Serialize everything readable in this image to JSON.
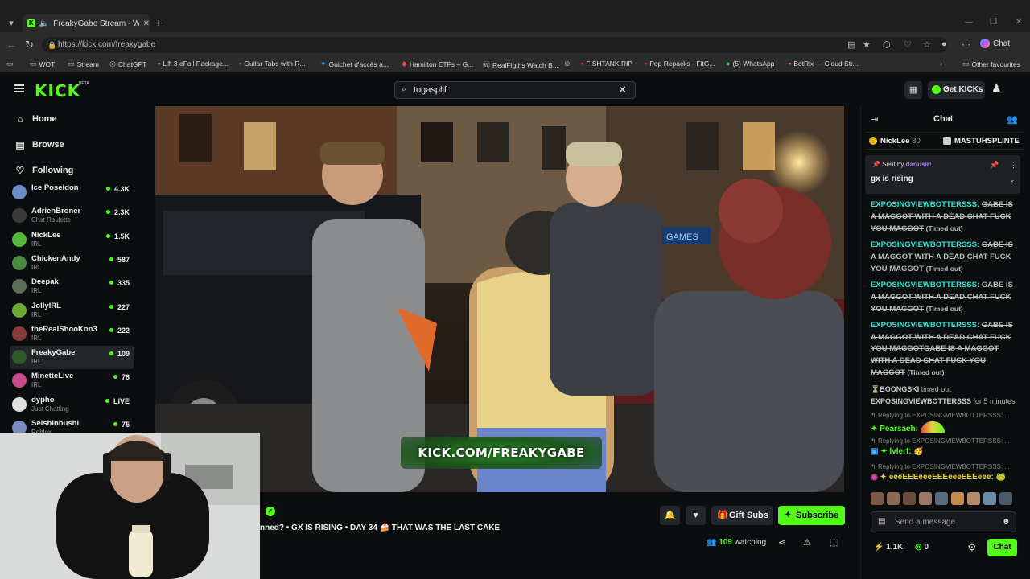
{
  "browser": {
    "tab_title": "FreakyGabe Stream - Watch Live",
    "url": "https://kick.com/freakygabe",
    "copilot_label": "Chat",
    "bookmarks": [
      "WOT",
      "Stream",
      "ChatGPT",
      "Lift 3 eFoil Package...",
      "Guitar Tabs with R...",
      "Guichet d'accès à...",
      "Hamilton ETFs – G...",
      "RealFigths Watch B...",
      "",
      "FISHTANK.RIP",
      "Pop Repacks - FitG...",
      "(5) WhatsApp",
      "BotRix — Cloud Str..."
    ],
    "other_favourites": "Other favourites"
  },
  "kick": {
    "logo": "KICK",
    "beta": "BETA",
    "search_value": "togasplif",
    "get_kicks": "Get KICKs"
  },
  "sidebar": {
    "nav": [
      {
        "label": "Home",
        "icon": "home-icon"
      },
      {
        "label": "Browse",
        "icon": "browse-icon"
      },
      {
        "label": "Following",
        "icon": "heart-icon"
      }
    ],
    "channels": [
      {
        "name": "Ice Poseidon",
        "category": "",
        "viewers": "4.3K",
        "color": "#6b8cc7"
      },
      {
        "name": "AdrienBroner",
        "category": "Chat Roulette",
        "viewers": "2.3K",
        "color": "#3a3a3a"
      },
      {
        "name": "NickLee",
        "category": "IRL",
        "viewers": "1.5K",
        "color": "#53b83a"
      },
      {
        "name": "ChickenAndy",
        "category": "IRL",
        "viewers": "587",
        "color": "#4b8a3f"
      },
      {
        "name": "Deepak",
        "category": "IRL",
        "viewers": "335",
        "color": "#5a6d55"
      },
      {
        "name": "JollyIRL",
        "category": "IRL",
        "viewers": "227",
        "color": "#6da832"
      },
      {
        "name": "theRealShooKon3",
        "category": "IRL",
        "viewers": "222",
        "color": "#8b3a3a"
      },
      {
        "name": "FreakyGabe",
        "category": "IRL",
        "viewers": "109",
        "color": "#2f5a2a"
      },
      {
        "name": "MinetteLive",
        "category": "IRL",
        "viewers": "78",
        "color": "#c94a8c"
      },
      {
        "name": "dypho",
        "category": "Just Chatting",
        "viewers": "LIVE",
        "color": "#e0e0e0"
      },
      {
        "name": "Seishinbushi",
        "category": "Roblox",
        "viewers": "75",
        "color": "#7a8dc2"
      }
    ]
  },
  "stream": {
    "watermark": "KICK.COM/FREAKYGABE",
    "title": "nned? • GX IS RISING • DAY 34 🍰 THAT WAS THE LAST CAKE",
    "gift_subs": "Gift Subs",
    "subscribe": "Subscribe",
    "watching_count": "109",
    "watching_label": "watching"
  },
  "chat": {
    "title": "Chat",
    "leaderboard": [
      {
        "name": "NickLee",
        "count": "80"
      },
      {
        "name": "MASTUHSPLINTE",
        "count": ""
      }
    ],
    "pinned": {
      "sent_by": "Sent by",
      "user": "dariusir!",
      "message": "gx is rising"
    },
    "messages": [
      {
        "user": "EXPOSINGVIEWBOTTERSSS:",
        "text": "GABE IS A MAGGOT WITH A DEAD CHAT FUCK YOU MAGGOT",
        "status": "(Timed out)"
      },
      {
        "user": "EXPOSINGVIEWBOTTERSSS:",
        "text": "GABE IS A MAGGOT WITH A DEAD CHAT FUCK YOU MAGGOT",
        "status": "(Timed out)"
      },
      {
        "user": "EXPOSINGVIEWBOTTERSSS:",
        "text": "GABE IS A MAGGOT WITH A DEAD CHAT FUCK YOU MAGGOT",
        "status": "(Timed out)"
      },
      {
        "user": "EXPOSINGVIEWBOTTERSSS:",
        "text": "GABE IS A MAGGOT WITH A DEAD CHAT FUCK YOU MAGGOTGABE IS A MAGGOT WITH A DEAD CHAT FUCK YOU MAGGOT",
        "status": "(Timed out)"
      }
    ],
    "timeout_event": {
      "moderator": "BOONGSKI",
      "action": "timed out",
      "target": "EXPOSINGVIEWBOTTERSSS",
      "duration": "for 5 minutes"
    },
    "replies": [
      {
        "replying_to": "Replying to EXPOSINGVIEWBOTTERSSS: ...",
        "user": "Pearsaeh:",
        "color": "#53fc18"
      },
      {
        "replying_to": "Replying to EXPOSINGVIEWBOTTERSSS: ...",
        "user": "lvlerf:",
        "color": "#53fc18"
      },
      {
        "replying_to": "Replying to EXPOSINGVIEWBOTTERSSS: ...",
        "user": "eeeEEEeeeEEEeeeEEEeee:",
        "color": "#e6d43a"
      }
    ],
    "input_placeholder": "Send a message",
    "kicks_count": "1.1K",
    "points_count": "0",
    "chat_button": "Chat"
  }
}
